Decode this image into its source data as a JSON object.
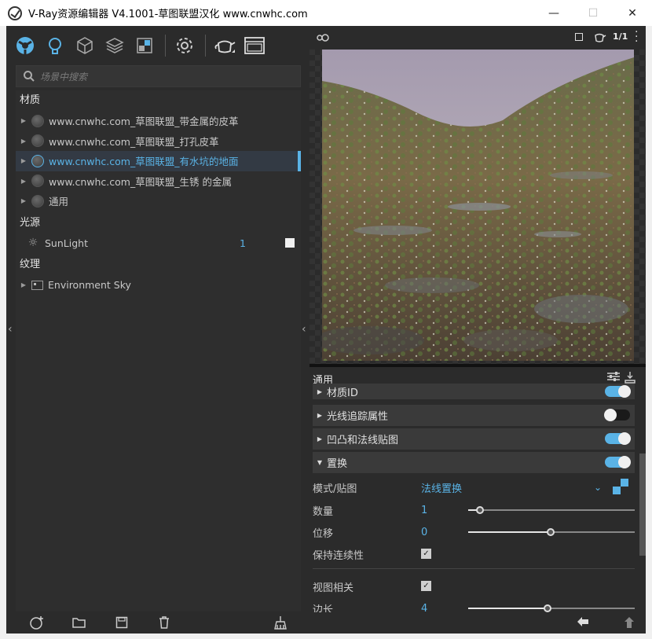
{
  "window": {
    "title": "V-Ray资源编辑器 V4.1001-草图联盟汉化 www.cnwhc.com",
    "minimize": "—",
    "maximize": "☐",
    "close": "✕"
  },
  "toolbar": {
    "icons": [
      "materials-icon",
      "lights-icon",
      "geometry-icon",
      "layers-icon",
      "textures-icon",
      "settings-icon",
      "render-teapot-icon",
      "frame-buffer-icon"
    ]
  },
  "search": {
    "placeholder": "场景中搜索"
  },
  "tree": {
    "materials_header": "材质",
    "materials": [
      {
        "label": "www.cnwhc.com_草图联盟_带金属的皮革"
      },
      {
        "label": "www.cnwhc.com_草图联盟_打孔皮革"
      },
      {
        "label": "www.cnwhc.com_草图联盟_有水坑的地面"
      },
      {
        "label": "www.cnwhc.com_草图联盟_生锈 的金属"
      },
      {
        "label": "通用"
      }
    ],
    "lights_header": "光源",
    "lights": [
      {
        "label": "SunLight",
        "count": "1"
      }
    ],
    "textures_header": "纹理",
    "textures": [
      {
        "label": "Environment Sky"
      }
    ]
  },
  "render_bar": {
    "ratio": "1/1"
  },
  "props": {
    "header": "通用",
    "sections": [
      {
        "label": "材质ID",
        "toggle": "on"
      },
      {
        "label": "光线追踪属性",
        "toggle": "off"
      },
      {
        "label": "凹凸和法线贴图",
        "toggle": "on"
      },
      {
        "label": "置换",
        "toggle": "on"
      }
    ],
    "mode_label": "模式/贴图",
    "mode_value": "法线置换",
    "amount_label": "数量",
    "amount_value": "1",
    "shift_label": "位移",
    "shift_value": "0",
    "continuity_label": "保持连续性",
    "view_label": "视图相关",
    "edge_label": "边长",
    "edge_value": "4"
  },
  "colors": {
    "accent": "#5ab3e6",
    "panel": "#2b2b2b",
    "selected_row": "#333a44"
  }
}
